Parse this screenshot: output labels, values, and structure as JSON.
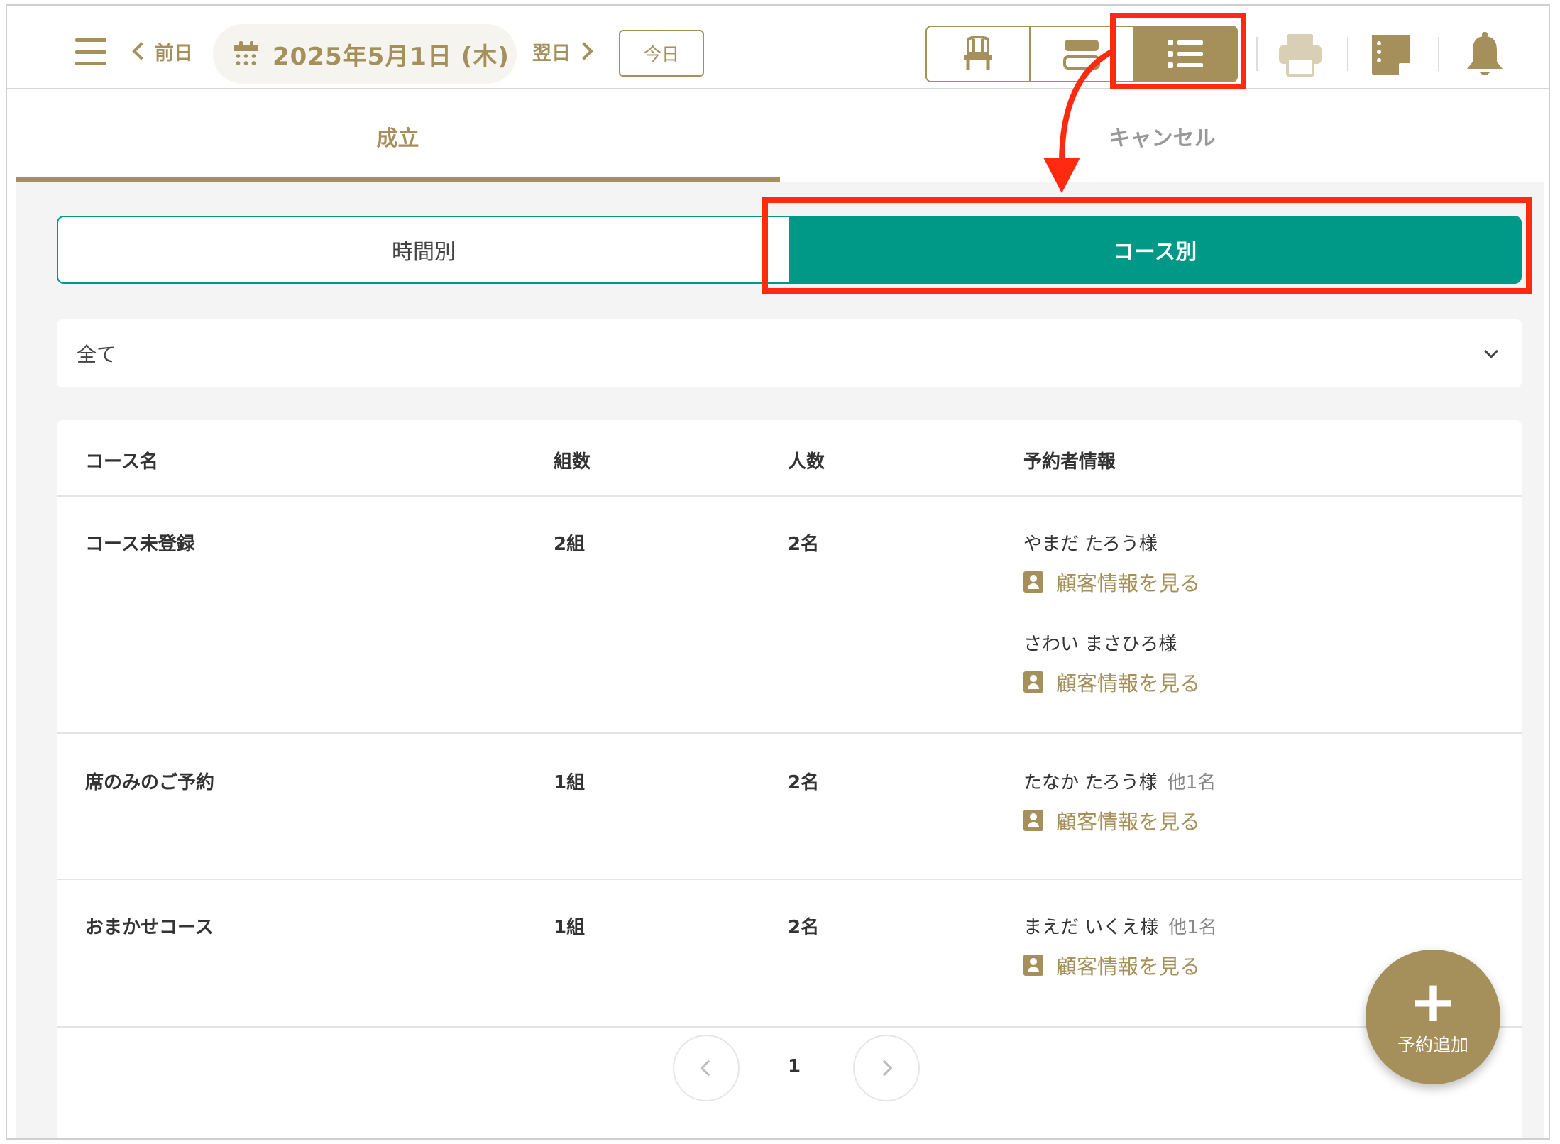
{
  "header": {
    "prev_label": "前日",
    "date": "2025年5月1日 (木)",
    "next_label": "翌日",
    "today_label": "今日"
  },
  "main_tabs": [
    {
      "label": "成立",
      "active": true
    },
    {
      "label": "キャンセル",
      "active": false
    }
  ],
  "segment": [
    {
      "label": "時間別",
      "active": false
    },
    {
      "label": "コース別",
      "active": true
    }
  ],
  "filter": {
    "selected": "全て"
  },
  "table": {
    "headers": [
      "コース名",
      "組数",
      "人数",
      "予約者情報"
    ],
    "link_label": "顧客情報を見る",
    "rows": [
      {
        "course": "コース未登録",
        "groups": "2組",
        "people": "2名",
        "customers": [
          {
            "name": "やまだ たろう様",
            "others": ""
          },
          {
            "name": "さわい まさひろ様",
            "others": ""
          }
        ]
      },
      {
        "course": "席のみのご予約",
        "groups": "1組",
        "people": "2名",
        "customers": [
          {
            "name": "たなか たろう様",
            "others": "他1名"
          }
        ]
      },
      {
        "course": "おまかせコース",
        "groups": "1組",
        "people": "2名",
        "customers": [
          {
            "name": "まえだ いくえ様",
            "others": "他1名"
          }
        ]
      }
    ]
  },
  "pager": {
    "current": "1"
  },
  "fab": {
    "label": "予約追加"
  },
  "colors": {
    "gold": "#a58f5a",
    "teal": "#009886",
    "annotation": "#ff2a10"
  }
}
